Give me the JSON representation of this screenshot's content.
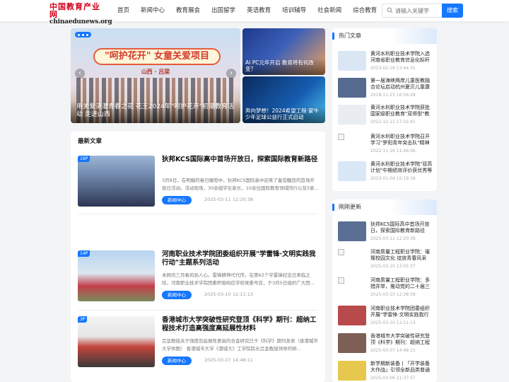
{
  "header": {
    "logo_cn": "中国教育产业网",
    "logo_en": "chinaedunews.org",
    "nav": [
      "首页",
      "新闻中心",
      "教育展会",
      "出国留学",
      "英语教育",
      "培训辅导",
      "社会新闻",
      "综合教育"
    ],
    "search_placeholder": "请输入关键字",
    "search_button": "搜索"
  },
  "carousel": {
    "banner": "\"呵护花开\" 女童关爱项目",
    "sub": "山西 · 吕梁",
    "caption": "用关爱浇灌青春之花 花王2024年\"呵护花开\"初潮教育活动 走进山西",
    "prev": "‹",
    "next": "›"
  },
  "tiles": [
    {
      "caption": "AI PC元年开启 教育将有何改变？"
    },
    {
      "caption": "奔向梦想！2024希望工程·蒙牛少年足球公益行正式启动"
    }
  ],
  "latest": {
    "title": "最新文章",
    "articles": [
      {
        "tag": "16P",
        "title": "狄邦KCS国际高中首场开放日，探索国际教育新路径",
        "summary": "3月8日，在明媚的春日暖阳中，狄邦KCS国际高中迎来了备受瞩目的首场开放日活动。活动现场，30余组学生家长、10余位国际教育领域同行以及5家...",
        "category": "新闻中心",
        "date": "2025-03-11 12:20:38"
      },
      {
        "tag": "14P",
        "title": "河南职业技术学院团委组织开展\"学雷锋·文明实践我行动\"主题系列活动",
        "summary": "本网讯三月春风骀人心，雷锋精神代代传。在第62个学雷锋纪念日来临之际，河南职业技术学院团委积极响应学校党委号召，于3月5日组织广大团...",
        "category": "新闻中心",
        "date": "2025-03-10 12:11:13"
      },
      {
        "tag": "3P",
        "title": "香港城市大学突破性研究登顶《科学》期刊：超纳工程技术打造高强度高延展性材料",
        "summary": "吕坚教授关于强度及延展性更高的合金研究已于《科学》期刊发表（香港城市大学供图） 香港城市大学《港城大》工学院院长吕坚教授领导的研...",
        "category": "新闻中心",
        "date": "2025-03-07 14:48:11"
      }
    ]
  },
  "hot": {
    "title": "热门文章",
    "items": [
      {
        "title": "黄河水利职业技术学院入选河南省职业教育信息化标杆学校",
        "date": "2023-02-18 13:44:31",
        "color": "#dbe6f5"
      },
      {
        "title": "第一届海峡两岸儿童医教融合论坛启动杭州夏贝儿童康复中心",
        "date": "2018-11-23 16:56:28",
        "color": "#556b8f"
      },
      {
        "title": "黄河水利职业技术学院获批国家级职业教育\"双师型\"教师培训基地",
        "date": "2022-12-11 17:32:41",
        "color": "#e9edf2"
      },
      {
        "title": "黄河水利职业技术学院召开学习\"罗阳青年突击队\"精神座谈会",
        "date": "2022-11-16 11:46:06",
        "color": ""
      },
      {
        "title": "黄河水利职业技术学院\"双高计划\"中期绩效评价获优秀等级",
        "date": "2023-01-04 15:19:18",
        "color": "#d9e7f7"
      }
    ]
  },
  "recent": {
    "title": "刚刚更新",
    "items": [
      {
        "title": "狄邦KCS国际高中首场开放日，探索国际教育新路径",
        "date": "2025-03-11 12:20:38",
        "color": "#5a6f93"
      },
      {
        "title": "河南质量工程职业学院：璀璨校园文化 绽放青春风采",
        "date": "2025-03-10 13:05:37",
        "color": ""
      },
      {
        "title": "河南质量工程职业学院：多措并举，推动党的二十届三中全会精神",
        "date": "2025-03-10 12:38:58",
        "color": ""
      },
      {
        "title": "河南职业技术学院团委组织开展\"学雷锋·文明实践我行动\"",
        "date": "2025-03-10 12:11:13",
        "color": "#b94a4c"
      },
      {
        "title": "香港城市大学突破性研究登顶《科学》期刊：超纳工程技术",
        "date": "2025-03-07 14:48:11",
        "color": "#7d5f55"
      },
      {
        "title": "新学期新装备丨「开学装备大作战」引领全新品类普通",
        "date": "2025-03-06 21:37:57",
        "color": "#e7c84f"
      }
    ]
  }
}
